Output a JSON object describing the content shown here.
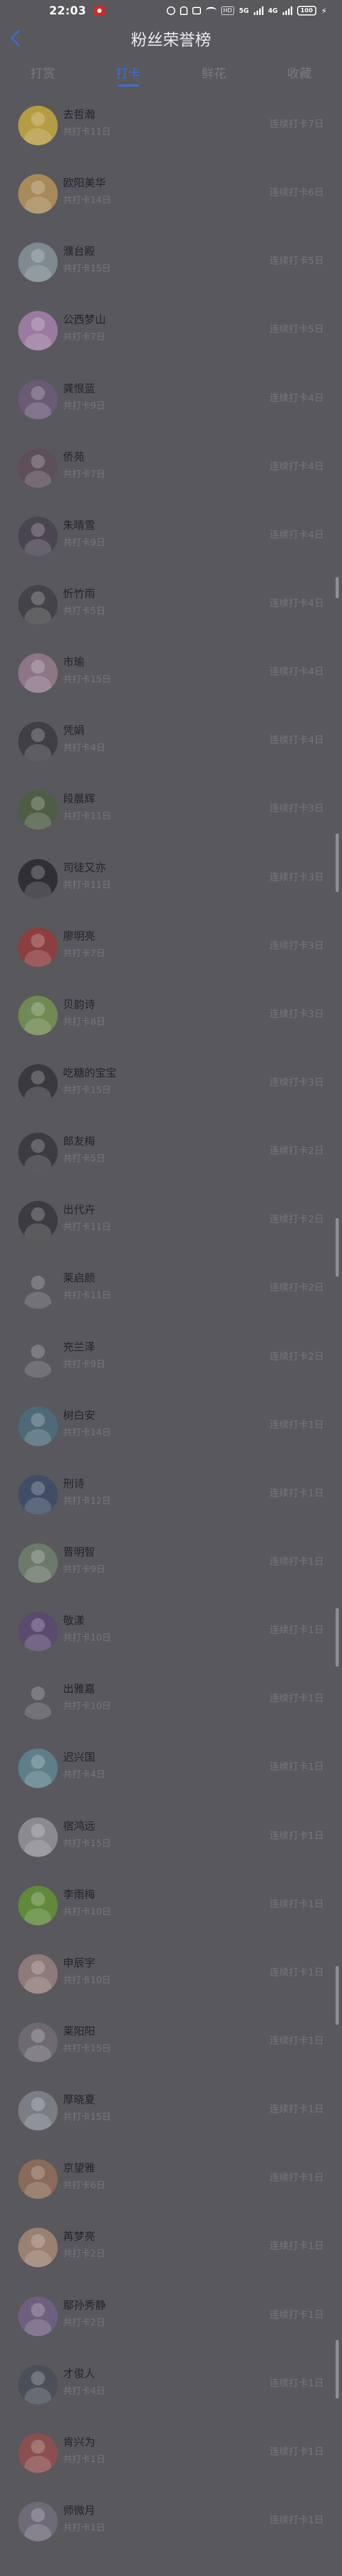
{
  "status": {
    "time": "22:03",
    "icons": [
      "app-notification-icon",
      "alarm-icon",
      "bell-icon",
      "mute-icon",
      "wifi-icon",
      "hd-icon",
      "signal-icon",
      "signal-icon",
      "battery-icon",
      "charging-icon"
    ],
    "hd": "HD",
    "net1": "5G",
    "net2": "4G",
    "battery": "100"
  },
  "header": {
    "title": "粉丝荣誉榜"
  },
  "tabs": [
    {
      "label": "打赏",
      "active": false
    },
    {
      "label": "打卡",
      "active": true
    },
    {
      "label": "鲜花",
      "active": false
    },
    {
      "label": "收藏",
      "active": false
    }
  ],
  "colors": {
    "accent": "#3b6fd8",
    "overlay": "#58585d"
  },
  "fans": [
    {
      "name": "去哲瀚",
      "total": "共打卡11日",
      "streak": "连续打卡7日",
      "color": "#b59c43"
    },
    {
      "name": "欧阳美华",
      "total": "共打卡14日",
      "streak": "连续打卡6日",
      "color": "#a88a5a"
    },
    {
      "name": "濮台殿",
      "total": "共打卡15日",
      "streak": "连续打卡5日",
      "color": "#7d8a8e"
    },
    {
      "name": "公西梦山",
      "total": "共打卡7日",
      "streak": "连续打卡5日",
      "color": "#9a7aa0"
    },
    {
      "name": "龚恨蓝",
      "total": "共打卡9日",
      "streak": "连续打卡4日",
      "color": "#6a5a75"
    },
    {
      "name": "侨苑",
      "total": "共打卡7日",
      "streak": "连续打卡4日",
      "color": "#5e4f5a"
    },
    {
      "name": "朱晴雪",
      "total": "共打卡9日",
      "streak": "连续打卡4日",
      "color": "#4b4550"
    },
    {
      "name": "忻竹雨",
      "total": "共打卡5日",
      "streak": "连续打卡4日",
      "color": "#444448"
    },
    {
      "name": "市瑜",
      "total": "共打卡15日",
      "streak": "连续打卡4日",
      "color": "#8d7685"
    },
    {
      "name": "凭娟",
      "total": "共打卡4日",
      "streak": "连续打卡4日",
      "color": "#3f3f44"
    },
    {
      "name": "段晨辉",
      "total": "共打卡11日",
      "streak": "连续打卡3日",
      "color": "#4e5e45"
    },
    {
      "name": "司徒又亦",
      "total": "共打卡11日",
      "streak": "连续打卡3日",
      "color": "#2f2f34"
    },
    {
      "name": "廖明亮",
      "total": "共打卡7日",
      "streak": "连续打卡3日",
      "color": "#8c3f3f"
    },
    {
      "name": "贝韵诗",
      "total": "共打卡8日",
      "streak": "连续打卡3日",
      "color": "#6f8a52"
    },
    {
      "name": "吃糖的宝宝",
      "total": "共打卡15日",
      "streak": "连续打卡3日",
      "color": "#3a3a3e"
    },
    {
      "name": "郎友梅",
      "total": "共打卡5日",
      "streak": "连续打卡2日",
      "color": "#3b3b40"
    },
    {
      "name": "出代卉",
      "total": "共打卡11日",
      "streak": "连续打卡2日",
      "color": "#3c3c40"
    },
    {
      "name": "莱启颜",
      "total": "共打卡11日",
      "streak": "连续打卡2日",
      "color": "#58585d"
    },
    {
      "name": "充兰泽",
      "total": "共打卡9日",
      "streak": "连续打卡2日",
      "color": "#58585d"
    },
    {
      "name": "树白安",
      "total": "共打卡14日",
      "streak": "连续打卡1日",
      "color": "#4e6a78"
    },
    {
      "name": "刑诗",
      "total": "共打卡12日",
      "streak": "连续打卡1日",
      "color": "#3f4e66"
    },
    {
      "name": "晋明智",
      "total": "共打卡9日",
      "streak": "连续打卡1日",
      "color": "#6b7a6a"
    },
    {
      "name": "敬漾",
      "total": "共打卡10日",
      "streak": "连续打卡1日",
      "color": "#5a4a6e"
    },
    {
      "name": "出雅嘉",
      "total": "共打卡10日",
      "streak": "连续打卡1日",
      "color": "#58585d"
    },
    {
      "name": "迟兴国",
      "total": "共打卡4日",
      "streak": "连续打卡1日",
      "color": "#5e7f8a"
    },
    {
      "name": "宿鸿远",
      "total": "共打卡15日",
      "streak": "连续打卡1日",
      "color": "#8a8a90"
    },
    {
      "name": "李雨梅",
      "total": "共打卡10日",
      "streak": "连续打卡1日",
      "color": "#5f8a3a"
    },
    {
      "name": "申辰宇",
      "total": "共打卡10日",
      "streak": "连续打卡1日",
      "color": "#8e7a78"
    },
    {
      "name": "莱阳阳",
      "total": "共打卡15日",
      "streak": "连续打卡1日",
      "color": "#6e6a70"
    },
    {
      "name": "厚晓夏",
      "total": "共打卡15日",
      "streak": "连续打卡1日",
      "color": "#7a7e84"
    },
    {
      "name": "京望雅",
      "total": "共打卡6日",
      "streak": "连续打卡1日",
      "color": "#8a6a58"
    },
    {
      "name": "苒梦亮",
      "total": "共打卡2日",
      "streak": "连续打卡1日",
      "color": "#9a8070"
    },
    {
      "name": "鄢孙秀静",
      "total": "共打卡2日",
      "streak": "连续打卡1日",
      "color": "#6f5f7e"
    },
    {
      "name": "才俊人",
      "total": "共打卡4日",
      "streak": "连续打卡1日",
      "color": "#4a4f5a"
    },
    {
      "name": "肯兴为",
      "total": "共打卡1日",
      "streak": "连续打卡1日",
      "color": "#8a5050"
    },
    {
      "name": "师微月",
      "total": "共打卡1日",
      "streak": "连续打卡1日",
      "color": "#6e6a78"
    }
  ]
}
